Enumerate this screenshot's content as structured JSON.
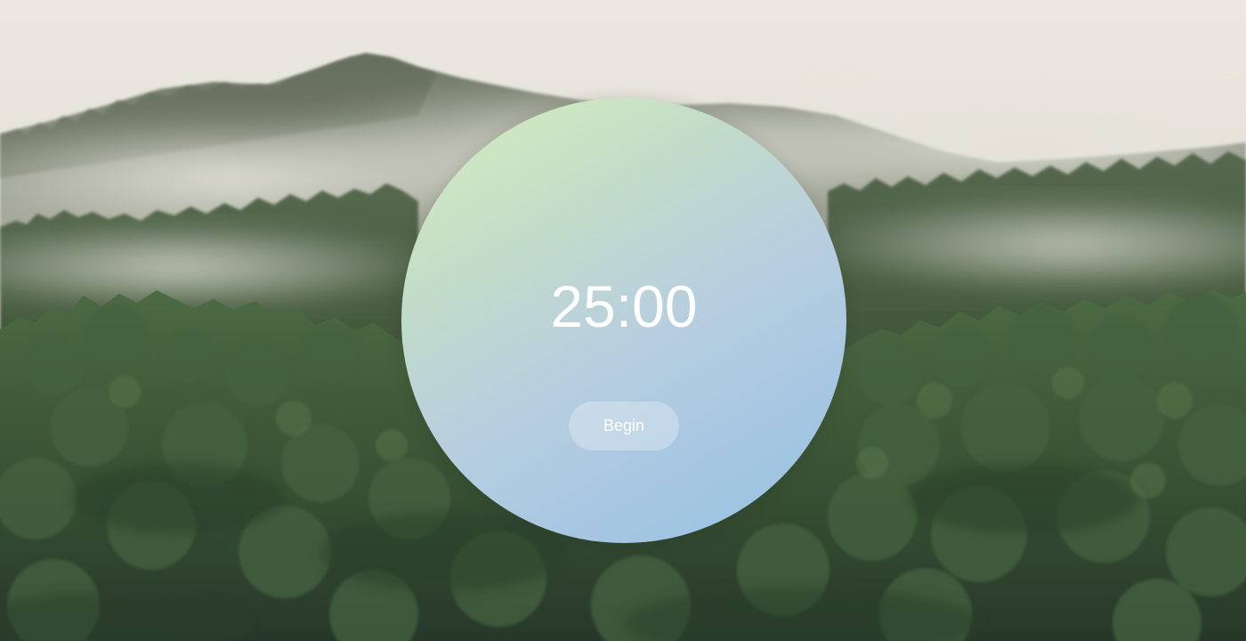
{
  "timer": {
    "display": "25:00"
  },
  "controls": {
    "begin_label": "Begin"
  },
  "background": {
    "scene": "misty-forest-mountain",
    "colors": {
      "sky": "#e6e4db",
      "mist": "#d4d6cc",
      "forest_dark": "#2f4230",
      "forest_mid": "#4a6545"
    }
  },
  "accent": {
    "gradient_start": "#d7efbc",
    "gradient_end": "#94c4e4"
  }
}
